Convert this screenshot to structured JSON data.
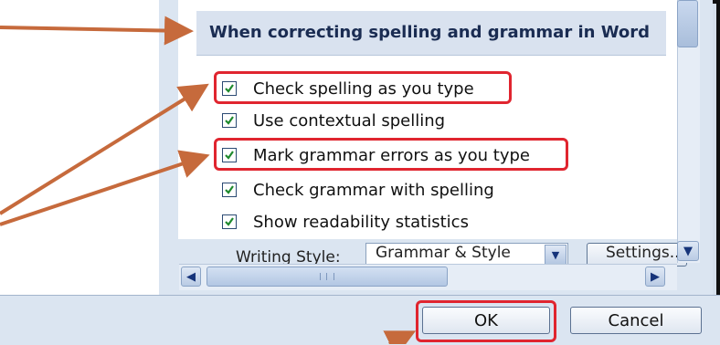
{
  "section": {
    "title": "When correcting spelling and grammar in Word"
  },
  "options": [
    {
      "label": "Check spelling as you type",
      "checked": true,
      "highlighted": true
    },
    {
      "label": "Use contextual spelling",
      "checked": true,
      "highlighted": false
    },
    {
      "label": "Mark grammar errors as you type",
      "checked": true,
      "highlighted": true
    },
    {
      "label": "Check grammar with spelling",
      "checked": true,
      "highlighted": false
    },
    {
      "label": "Show readability statistics",
      "checked": true,
      "highlighted": false
    }
  ],
  "writing_style": {
    "label": "Writing Style:",
    "value": "Grammar & Style",
    "settings_label": "Settings..."
  },
  "footer": {
    "ok_label": "OK",
    "cancel_label": "Cancel"
  },
  "colors": {
    "highlight": "#e0252f",
    "arrow": "#c66a3c",
    "title": "#1a2c52"
  }
}
